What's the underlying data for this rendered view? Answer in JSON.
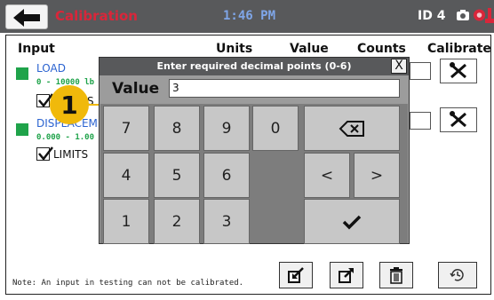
{
  "header": {
    "title": "Calibration",
    "time": "1:46 PM",
    "id_label": "ID 4"
  },
  "table": {
    "headers": {
      "input": "Input",
      "units": "Units",
      "value": "Value",
      "counts": "Counts",
      "calibrate": "Calibrate"
    },
    "channels": [
      {
        "name": "LOAD",
        "range": "0 - 10000 lb",
        "limits_label": "S"
      },
      {
        "name": "DISPLACEM",
        "range": "0.000 - 1.00",
        "limits_label": "LIMITS"
      }
    ]
  },
  "footer": {
    "note": "Note: An input in testing can not be calibrated."
  },
  "dialog": {
    "title": "Enter required decimal points (0-6)",
    "close": "X",
    "value_label": "Value",
    "value": "3",
    "keys": {
      "k7": "7",
      "k8": "8",
      "k9": "9",
      "k0": "0",
      "k4": "4",
      "k5": "5",
      "k6": "6",
      "k1": "1",
      "k2": "2",
      "k3": "3",
      "left": "<",
      "right": ">"
    }
  },
  "annotation": {
    "step": "1"
  },
  "colors": {
    "topbar": "#58595b",
    "title": "#d9263a",
    "time": "#7fa6e8",
    "status_green": "#1fa34a",
    "badge": "#f0b90b",
    "dialog_bg": "#9c9c9c"
  }
}
